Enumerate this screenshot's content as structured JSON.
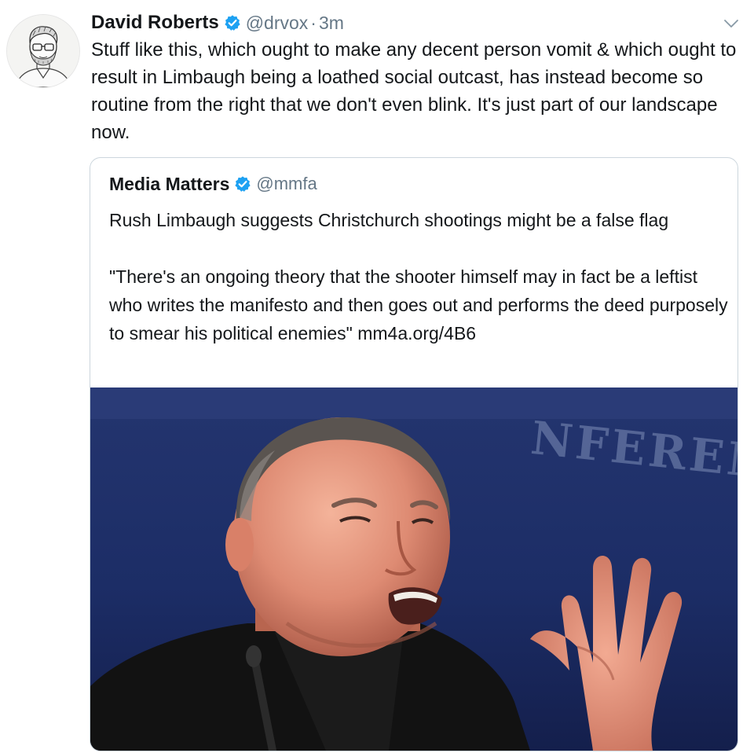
{
  "tweet": {
    "author_name": "David Roberts",
    "handle": "@drvox",
    "separator": "·",
    "timestamp": "3m",
    "text": "Stuff like this, which ought to make any decent person vomit & which ought to result in Limbaugh being a loathed social outcast, has instead become so routine from the right that we don't even blink. It's just part of our landscape now."
  },
  "quoted_tweet": {
    "author_name": "Media Matters",
    "handle": "@mmfa",
    "headline": "Rush Limbaugh suggests Christchurch shootings might be a false flag",
    "quote": "\"There's an ongoing theory that the shooter himself may in fact be a leftist who writes the manifesto and then goes out and performs the deed purposely to smear his political enemies\" mm4a.org/4B6",
    "media": {
      "background_lettering": "NFERENC"
    }
  },
  "icons": {
    "verified": "verified-badge-icon",
    "menu": "chevron-down-icon"
  },
  "colors": {
    "text": "#14171a",
    "secondary": "#657786",
    "verified": "#1da1f2",
    "border": "#ccd6dd",
    "photo_background": "#1c2d66"
  }
}
